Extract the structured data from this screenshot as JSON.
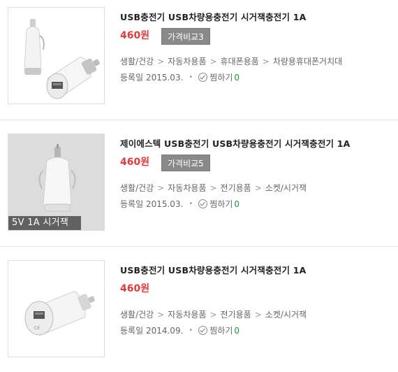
{
  "products": [
    {
      "title": "USB충전기 USB차량용충전기 시거잭충전기 1A",
      "price": "460원",
      "compare": "가격비교3",
      "categories": [
        "생활/건강",
        "자동차용품",
        "휴대폰용품",
        "차량용휴대폰거치대"
      ],
      "reg_label": "등록일",
      "reg_date": "2015.03.",
      "wish_label": "찜하기",
      "wish_count": "0",
      "caption": ""
    },
    {
      "title": "제이에스텍 USB충전기 USB차량용충전기 시거잭충전기 1A",
      "price": "460원",
      "compare": "가격비교5",
      "categories": [
        "생활/건강",
        "자동차용품",
        "전기용품",
        "소켓/시거잭"
      ],
      "reg_label": "등록일",
      "reg_date": "2015.03.",
      "wish_label": "찜하기",
      "wish_count": "0",
      "caption": "5V 1A 시거잭"
    },
    {
      "title": "USB충전기 USB차량용충전기 시거잭충전기 1A",
      "price": "460원",
      "compare": "",
      "categories": [
        "생활/건강",
        "자동차용품",
        "전기용품",
        "소켓/시거잭"
      ],
      "reg_label": "등록일",
      "reg_date": "2014.09.",
      "wish_label": "찜하기",
      "wish_count": "0",
      "caption": ""
    }
  ],
  "colors": {
    "price": "#e03a3e",
    "compare_bg": "#898989",
    "wish_count": "#1a9b3c"
  }
}
